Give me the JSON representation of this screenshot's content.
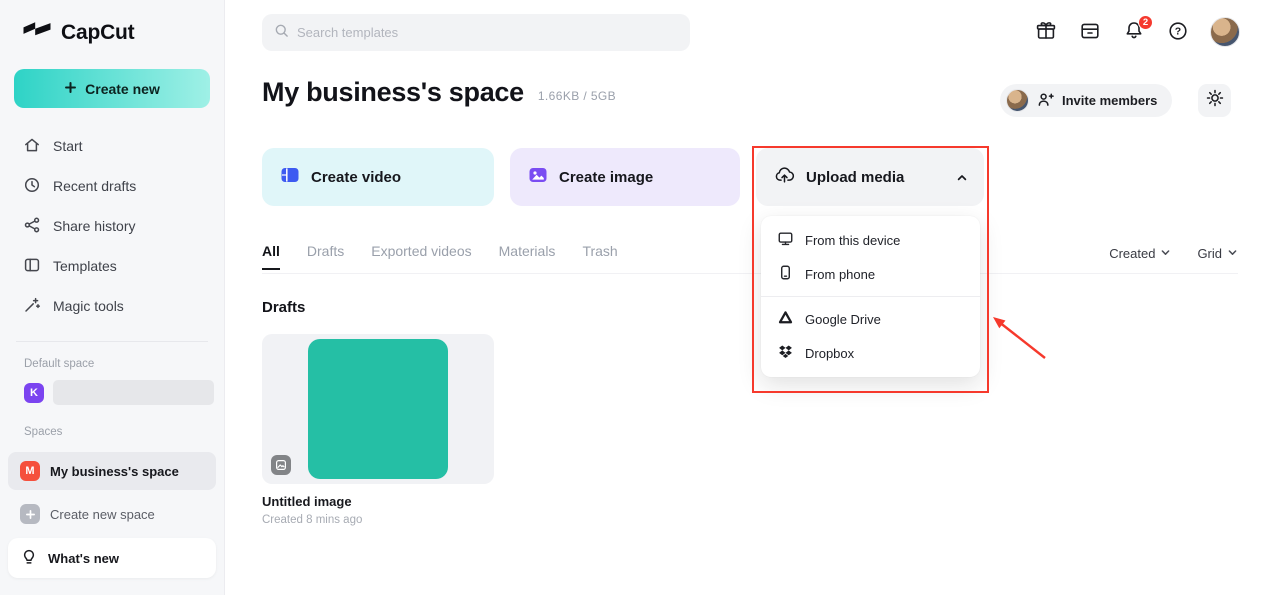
{
  "app": {
    "name": "CapCut"
  },
  "colors": {
    "accent_gradient_start": "#2ed3c6",
    "accent_gradient_end": "#9ff0e6",
    "highlight_red": "#f6392c",
    "thumbnail_teal": "#25bfa5",
    "create_video_bg": "#e0f6f9",
    "create_image_bg": "#eee9fc",
    "upload_media_bg": "#f2f3f5",
    "default_space_avatar": "#7b44f0",
    "business_space_avatar": "#f5503c"
  },
  "sidebar": {
    "logo_text": "CapCut",
    "create_new_label": "Create new",
    "items": [
      {
        "label": "Start",
        "icon": "home-icon"
      },
      {
        "label": "Recent drafts",
        "icon": "clock-icon"
      },
      {
        "label": "Share history",
        "icon": "share-icon"
      },
      {
        "label": "Templates",
        "icon": "templates-icon"
      },
      {
        "label": "Magic tools",
        "icon": "magic-wand-icon"
      }
    ],
    "default_space_label": "Default space",
    "default_space_initial": "K",
    "spaces_label": "Spaces",
    "active_space": {
      "initial": "M",
      "name": "My business's space"
    },
    "create_new_space_label": "Create new space",
    "whats_new_label": "What's new"
  },
  "header": {
    "search_placeholder": "Search templates",
    "notification_count": "2",
    "icons": [
      "gift-icon",
      "storage-box-icon",
      "notifications-icon",
      "help-icon",
      "user-avatar"
    ]
  },
  "main": {
    "title": "My business's space",
    "storage": "1.66KB / 5GB",
    "invite_members_label": "Invite members",
    "actions": [
      {
        "label": "Create video",
        "icon": "video-icon"
      },
      {
        "label": "Create image",
        "icon": "image-icon"
      },
      {
        "label": "Upload media",
        "icon": "cloud-upload-icon"
      }
    ],
    "upload_menu": [
      {
        "label": "From this device",
        "icon": "monitor-icon"
      },
      {
        "label": "From phone",
        "icon": "phone-icon"
      },
      {
        "label": "Google Drive",
        "icon": "google-drive-icon"
      },
      {
        "label": "Dropbox",
        "icon": "dropbox-icon"
      }
    ],
    "tabs": [
      "All",
      "Drafts",
      "Exported videos",
      "Materials",
      "Trash"
    ],
    "active_tab": "All",
    "sort_by_label": "Created",
    "view_label": "Grid",
    "section_title": "Drafts",
    "draft": {
      "title": "Untitled image",
      "meta": "Created 8 mins ago"
    }
  }
}
